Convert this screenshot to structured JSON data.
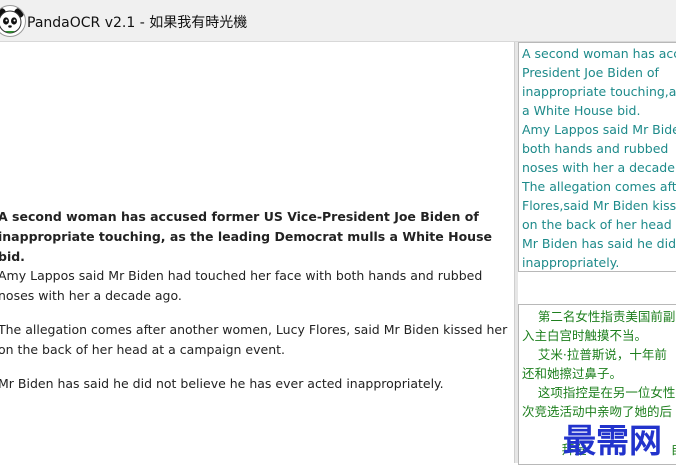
{
  "window": {
    "title": "PandaOCR v2.1  -  如果我有時光機",
    "app_icon": "panda-icon"
  },
  "source_article": {
    "headline": "A second woman has accused former US Vice-President Joe Biden of inappropriate touching, as the leading Democrat mulls a White House bid.",
    "paragraphs": [
      "Amy Lappos said Mr Biden had touched her face with both hands and rubbed noses with her a decade ago.",
      "The allegation comes after another women, Lucy Flores, said Mr Biden kissed her on the back of her head at a campaign event.",
      "Mr Biden has said he did not believe he has ever acted inappropriately."
    ]
  },
  "ocr_result": {
    "lines": [
      "A second woman has acc",
      "President Joe Biden of",
      "inappropriate touching,as",
      "a White House bid.",
      "Amy Lappos said Mr Bide",
      "both hands and rubbed",
      "noses with her a decade a",
      "The allegation comes afte",
      "Flores,said Mr Biden kisse",
      "on the back of her head a",
      "Mr Biden has said he did",
      "inappropriately."
    ]
  },
  "translation_result": {
    "lines": [
      "    第二名女性指责美国前副",
      "入主白宫时触摸不当。",
      "    艾米·拉普斯说，十年前",
      "还和她擦过鼻子。",
      "    这项指控是在另一位女性",
      "次竞选活动中亲吻了她的后",
      "    拜登",
      "自己"
    ]
  },
  "watermark": {
    "text": "最需网"
  }
}
